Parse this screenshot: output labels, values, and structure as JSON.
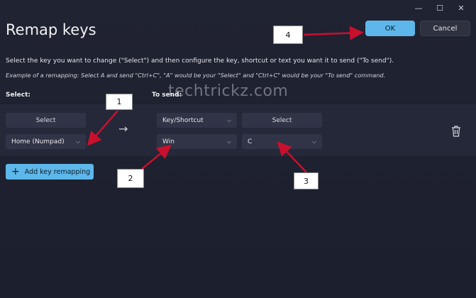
{
  "window": {
    "minimize": "—",
    "maximize": "☐",
    "close": "✕"
  },
  "header": {
    "title": "Remap keys",
    "ok_label": "OK",
    "cancel_label": "Cancel"
  },
  "text": {
    "instruction": "Select the key you want to change (\"Select\") and then configure the key, shortcut or text you want it to send (\"To send\").",
    "example": "Example of a remapping: Select A and send \"Ctrl+C\", \"A\" would be your \"Select\" and \"Ctrl+C\" would be your \"To send\" command."
  },
  "columns": {
    "select": "Select:",
    "to_send": "To send:"
  },
  "watermark": "techtrickz.com",
  "row": {
    "select_button": "Select",
    "original_key": "Home (Numpad)",
    "send_type": "Key/Shortcut",
    "send_select_button": "Select",
    "send_key_1": "Win",
    "send_key_2": "C"
  },
  "add_button_label": "Add key remapping",
  "callouts": [
    "1",
    "2",
    "3",
    "4"
  ],
  "icons": {
    "chevron": "chevron-down-icon",
    "arrow": "arrow-right-icon",
    "delete": "trash-icon",
    "add": "plus-icon"
  },
  "colors": {
    "accent": "#5db7ea",
    "annotation_arrow": "#c8102e"
  }
}
